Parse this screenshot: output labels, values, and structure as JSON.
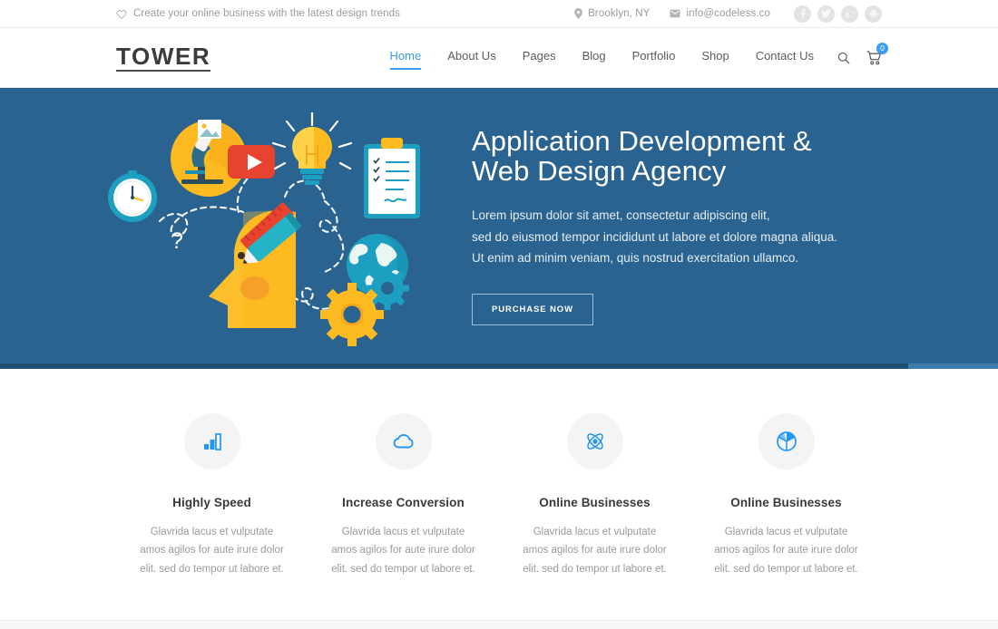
{
  "topbar": {
    "tagline": "Create your online business with the latest design trends",
    "heart_icon": "heart-icon",
    "location": "Brooklyn, NY",
    "location_icon": "map-pin-icon",
    "email": "info@codeless.co",
    "email_icon": "envelope-icon",
    "socials": [
      {
        "name": "facebook-icon",
        "glyph": "f"
      },
      {
        "name": "twitter-icon",
        "glyph": "t"
      },
      {
        "name": "google-plus-icon",
        "glyph": "g"
      },
      {
        "name": "printer-icon",
        "glyph": "p"
      }
    ]
  },
  "header": {
    "logo": "TOWER",
    "nav": [
      {
        "label": "Home",
        "active": true
      },
      {
        "label": "About Us",
        "active": false
      },
      {
        "label": "Pages",
        "active": false
      },
      {
        "label": "Blog",
        "active": false
      },
      {
        "label": "Portfolio",
        "active": false
      },
      {
        "label": "Shop",
        "active": false
      },
      {
        "label": "Contact Us",
        "active": false
      }
    ],
    "search_icon": "search-icon",
    "cart_icon": "shopping-cart-icon",
    "cart_count": "0"
  },
  "hero": {
    "title_line1": "Application Development &",
    "title_line2": "Web Design Agency",
    "sub_line1": "Lorem ipsum dolor sit amet, consectetur adipiscing elit,",
    "sub_line2": "sed do eiusmod tempor incididunt ut labore et dolore magna aliqua.",
    "sub_line3": "Ut enim ad minim veniam, quis nostrud exercitation ullamco.",
    "button_label": "PURCHASE NOW",
    "progress_percent": "91",
    "background_color": "#2b6390",
    "illustration": "brain-head-creative-process-illustration"
  },
  "features": [
    {
      "icon": "bar-chart-icon",
      "title": "Highly Speed",
      "desc": "Glavrida lacus et vulputate amos agilos for aute irure dolor elit. sed do tempor ut labore et."
    },
    {
      "icon": "cloud-icon",
      "title": "Increase Conversion",
      "desc": "Glavrida lacus et vulputate amos agilos for aute irure dolor elit. sed do tempor ut labore et."
    },
    {
      "icon": "atom-icon",
      "title": "Online Businesses",
      "desc": "Glavrida lacus et vulputate amos agilos for aute irure dolor elit. sed do tempor ut labore et."
    },
    {
      "icon": "pie-chart-icon",
      "title": "Online Businesses",
      "desc": "Glavrida lacus et vulputate amos agilos for aute irure dolor elit. sed do tempor ut labore et."
    }
  ],
  "theme": {
    "accent": "#3b9cf0",
    "hero_bg": "#2b6390",
    "text_dark": "#3a3a3a",
    "text_muted": "#9a9a9a"
  }
}
